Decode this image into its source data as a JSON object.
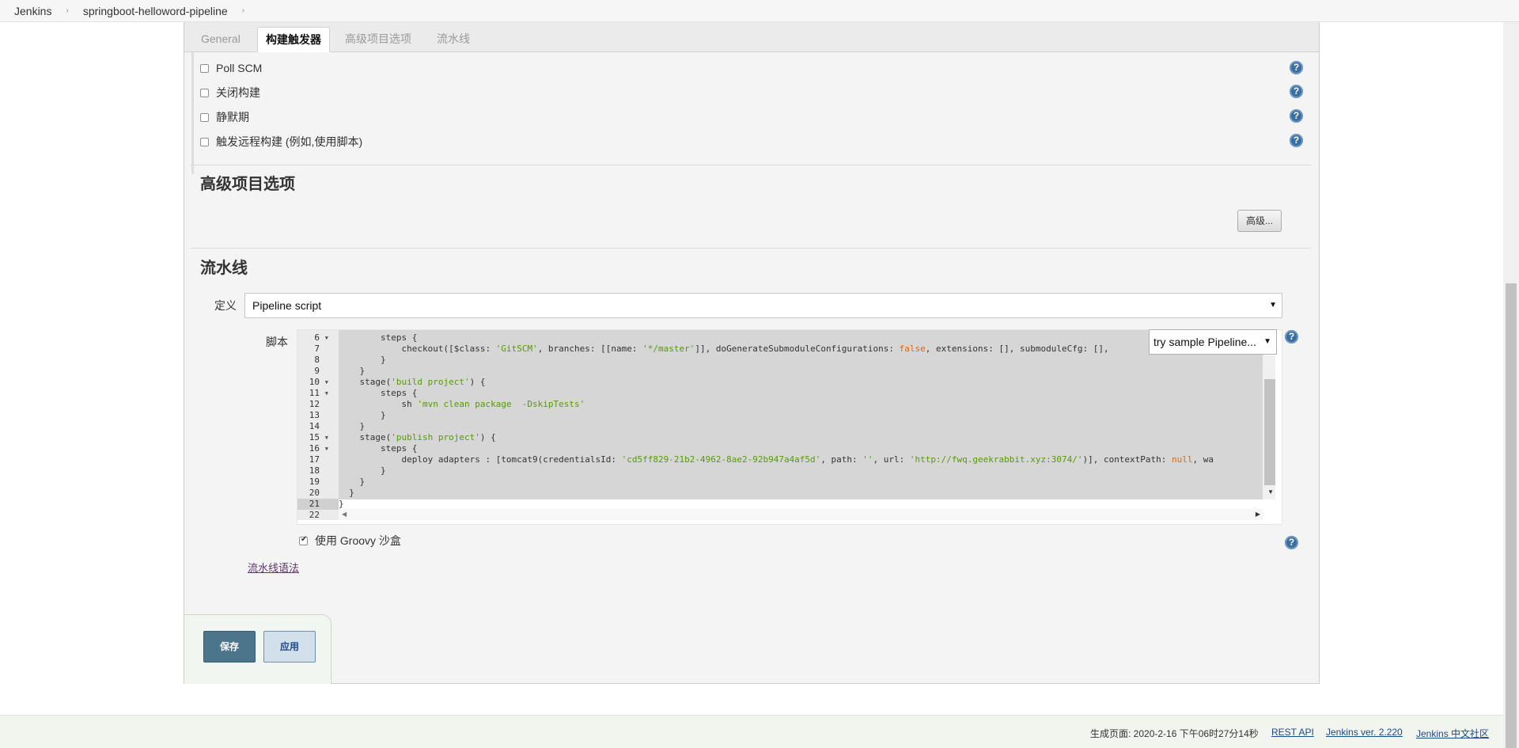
{
  "breadcrumb": {
    "items": [
      "Jenkins",
      "springboot-helloword-pipeline"
    ],
    "separator": "›"
  },
  "tabs": [
    {
      "label": "General",
      "active": false
    },
    {
      "label": "构建触发器",
      "active": true
    },
    {
      "label": "高级项目选项",
      "active": false
    },
    {
      "label": "流水线",
      "active": false
    }
  ],
  "triggers": [
    {
      "label": "Poll SCM",
      "checked": false
    },
    {
      "label": "关闭构建",
      "checked": false
    },
    {
      "label": "静默期",
      "checked": false
    },
    {
      "label": "触发远程构建 (例如,使用脚本)",
      "checked": false
    }
  ],
  "advanced_section": {
    "title": "高级项目选项",
    "button_label": "高级..."
  },
  "pipeline_section": {
    "title": "流水线",
    "definition_label": "定义",
    "definition_value": "Pipeline script",
    "script_label": "脚本",
    "sample_select_value": "try sample Pipeline...",
    "sandbox_label": "使用 Groovy 沙盒",
    "sandbox_checked": true,
    "syntax_link": "流水线语法"
  },
  "editor": {
    "active_line": "21",
    "lines": [
      {
        "num": "6",
        "fold": true,
        "indent": "        ",
        "parts": [
          [
            "steps {",
            ""
          ]
        ]
      },
      {
        "num": "7",
        "fold": false,
        "indent": "            ",
        "parts": [
          [
            "checkout([$class: ",
            ""
          ],
          [
            "'GitSCM'",
            "str"
          ],
          [
            ", branches: [[name: ",
            ""
          ],
          [
            "'*/master'",
            "str"
          ],
          [
            "]], doGenerateSubmoduleConfigurations: ",
            ""
          ],
          [
            "false",
            "kw"
          ],
          [
            ", extensions: [], submoduleCfg: [], ",
            ""
          ]
        ]
      },
      {
        "num": "8",
        "fold": false,
        "indent": "        ",
        "parts": [
          [
            "}",
            ""
          ]
        ]
      },
      {
        "num": "9",
        "fold": false,
        "indent": "    ",
        "parts": [
          [
            "}",
            ""
          ]
        ]
      },
      {
        "num": "10",
        "fold": true,
        "indent": "    ",
        "parts": [
          [
            "stage(",
            ""
          ],
          [
            "'build project'",
            "str"
          ],
          [
            ") {",
            ""
          ]
        ]
      },
      {
        "num": "11",
        "fold": true,
        "indent": "        ",
        "parts": [
          [
            "steps {",
            ""
          ]
        ]
      },
      {
        "num": "12",
        "fold": false,
        "indent": "            ",
        "parts": [
          [
            "sh ",
            ""
          ],
          [
            "'mvn clean package  -DskipTests'",
            "str"
          ]
        ]
      },
      {
        "num": "13",
        "fold": false,
        "indent": "        ",
        "parts": [
          [
            "}",
            ""
          ]
        ]
      },
      {
        "num": "14",
        "fold": false,
        "indent": "    ",
        "parts": [
          [
            "}",
            ""
          ]
        ]
      },
      {
        "num": "15",
        "fold": true,
        "indent": "    ",
        "parts": [
          [
            "stage(",
            ""
          ],
          [
            "'publish project'",
            "str"
          ],
          [
            ") {",
            ""
          ]
        ]
      },
      {
        "num": "16",
        "fold": true,
        "indent": "        ",
        "parts": [
          [
            "steps {",
            ""
          ]
        ]
      },
      {
        "num": "17",
        "fold": false,
        "indent": "            ",
        "parts": [
          [
            "deploy adapters : [tomcat9(credentialsId: ",
            ""
          ],
          [
            "'cd5ff829-21b2-4962-8ae2-92b947a4af5d'",
            "str"
          ],
          [
            ", path: ",
            ""
          ],
          [
            "''",
            "str"
          ],
          [
            ", url: ",
            ""
          ],
          [
            "'http://fwq.geekrabbit.xyz:3074/'",
            "str"
          ],
          [
            ")], contextPath: ",
            ""
          ],
          [
            "null",
            "kw"
          ],
          [
            ", wa",
            ""
          ]
        ]
      },
      {
        "num": "18",
        "fold": false,
        "indent": "        ",
        "parts": [
          [
            "}",
            ""
          ]
        ]
      },
      {
        "num": "19",
        "fold": false,
        "indent": "    ",
        "parts": [
          [
            "}",
            ""
          ]
        ]
      },
      {
        "num": "20",
        "fold": false,
        "indent": "  ",
        "parts": [
          [
            "}",
            ""
          ]
        ]
      },
      {
        "num": "21",
        "fold": false,
        "indent": "",
        "parts": [
          [
            "}",
            ""
          ]
        ]
      },
      {
        "num": "22",
        "fold": false,
        "indent": "",
        "parts": []
      }
    ]
  },
  "buttons": {
    "save": "保存",
    "apply": "应用"
  },
  "footer": {
    "generated": "生成页面: 2020-2-16 下午06时27分14秒",
    "rest_api": "REST API",
    "version": "Jenkins ver. 2.220",
    "community": "Jenkins 中文社区"
  },
  "colors": {
    "string_literal": "#559a08",
    "keyword": "#d2691e",
    "save_button": "#4b758b",
    "help_icon": "#3b6ea0"
  }
}
